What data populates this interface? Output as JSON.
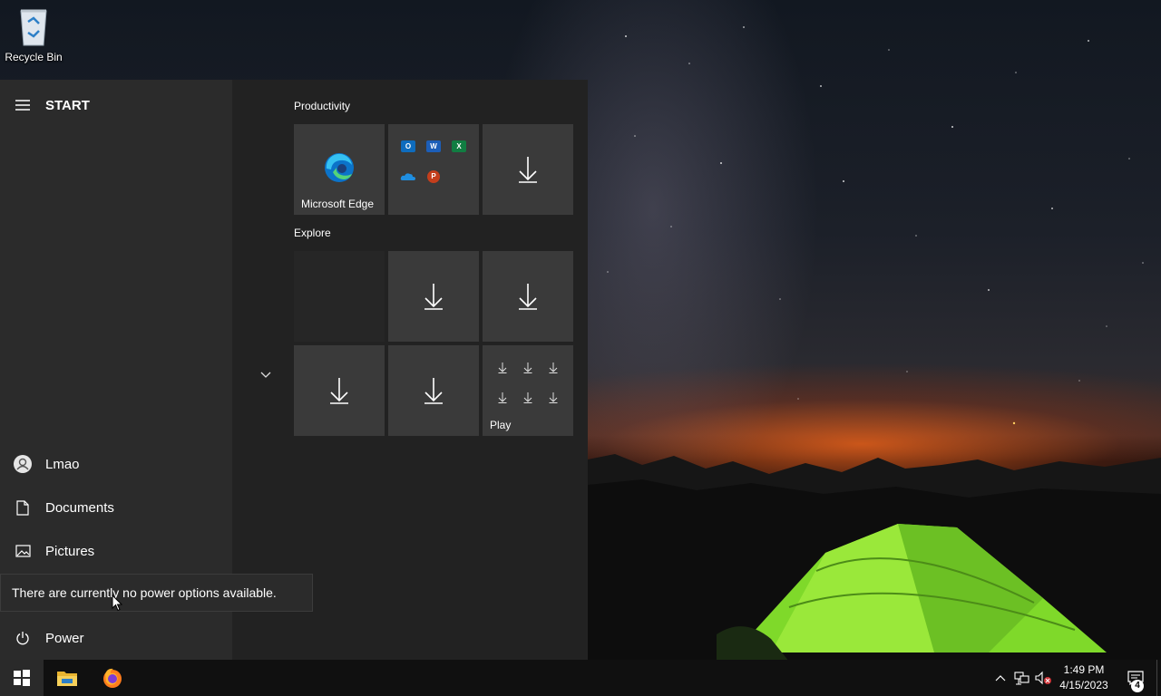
{
  "desktop": {
    "icons": [
      {
        "label": "Recycle Bin",
        "icon": "recycle-bin-icon"
      }
    ]
  },
  "start_menu": {
    "header": "START",
    "groups": [
      {
        "label": "Productivity",
        "tiles": [
          {
            "label": "Microsoft Edge",
            "icon": "edge-icon"
          },
          {
            "label": "",
            "icon": "office-apps-group"
          },
          {
            "label": "",
            "icon": "download-arrow-icon"
          }
        ]
      },
      {
        "label": "Explore",
        "tiles": [
          {
            "label": "",
            "icon": ""
          },
          {
            "label": "",
            "icon": "download-arrow-icon"
          },
          {
            "label": "",
            "icon": "download-arrow-icon"
          },
          {
            "label": "",
            "icon": "download-arrow-icon"
          },
          {
            "label": "",
            "icon": "download-arrow-icon"
          },
          {
            "label": "Play",
            "icon": "play-folder-icon"
          }
        ]
      }
    ],
    "office_apps": [
      {
        "letter": "O",
        "color": "#0f6cbd"
      },
      {
        "letter": "W",
        "color": "#1c5eb8"
      },
      {
        "letter": "X",
        "color": "#117d42"
      },
      {
        "letter": "",
        "color": "#1f8ee0"
      },
      {
        "letter": "P",
        "color": "#c43e1c"
      }
    ],
    "sidebar": {
      "user": "Lmao",
      "documents": "Documents",
      "pictures": "Pictures",
      "power": "Power"
    },
    "power_tooltip": "There are currently no power options available."
  },
  "taskbar": {
    "time": "1:49 PM",
    "date": "4/15/2023",
    "notification_count": "4"
  },
  "colors": {
    "sidebar_bg": "#2b2b2b",
    "tiles_bg": "#222222",
    "tile_bg": "#3a3a3a",
    "taskbar_bg": "#101010",
    "tent_green": "#7fd92a"
  }
}
